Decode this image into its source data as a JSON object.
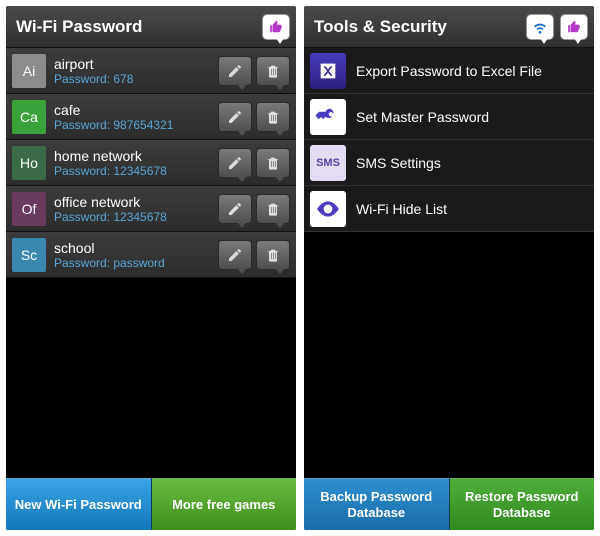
{
  "left": {
    "title": "Wi-Fi Password",
    "items": [
      {
        "abbrev": "Ai",
        "color": "#8c8c8c",
        "name": "airport",
        "password": "Password: 678"
      },
      {
        "abbrev": "Ca",
        "color": "#3aa23a",
        "name": "cafe",
        "password": "Password: 987654321"
      },
      {
        "abbrev": "Ho",
        "color": "#3a6b46",
        "name": "home network",
        "password": "Password: 12345678"
      },
      {
        "abbrev": "Of",
        "color": "#6b3a5f",
        "name": "office network",
        "password": "Password: 12345678"
      },
      {
        "abbrev": "Sc",
        "color": "#3a87b0",
        "name": "school",
        "password": "Password: password"
      }
    ],
    "button_left": "New Wi-Fi Password",
    "button_right": "More free games"
  },
  "right": {
    "title": "Tools & Security",
    "items": [
      {
        "icon": "excel",
        "label": "Export Password to Excel File"
      },
      {
        "icon": "key",
        "label": "Set Master Password"
      },
      {
        "icon": "sms",
        "label": "SMS Settings"
      },
      {
        "icon": "eye",
        "label": "Wi-Fi Hide List"
      }
    ],
    "button_left": "Backup Password Database",
    "button_right": "Restore Password Database"
  }
}
